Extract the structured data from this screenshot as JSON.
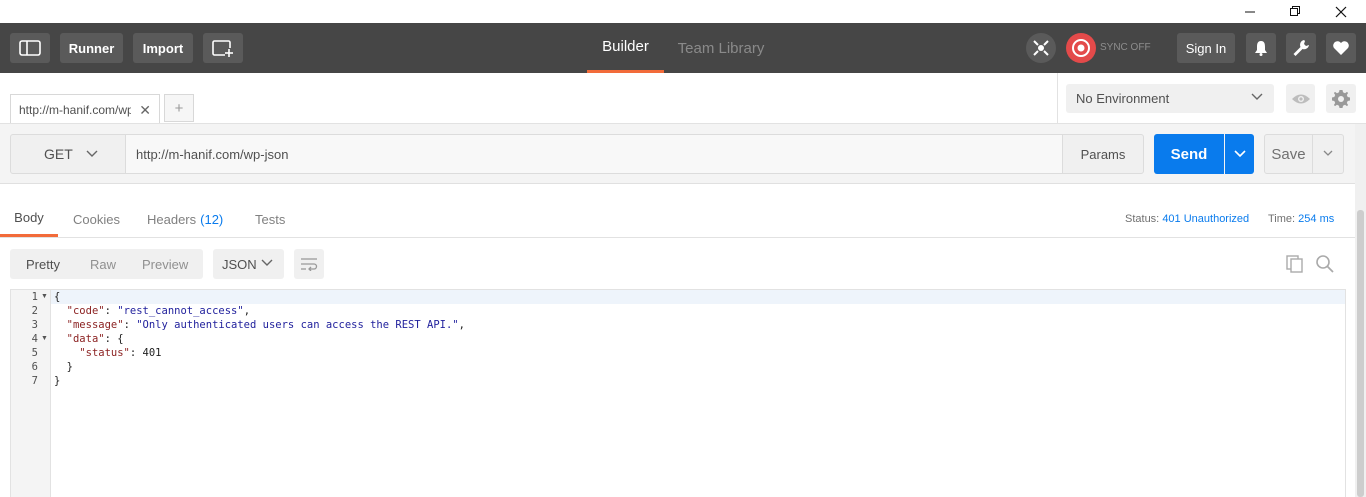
{
  "window": {
    "minimize": "—",
    "restore": "❐",
    "close": "✕"
  },
  "header": {
    "runner": "Runner",
    "import": "Import",
    "tabs": [
      {
        "label": "Builder",
        "active": true
      },
      {
        "label": "Team Library",
        "active": false
      }
    ],
    "sync_label": "SYNC OFF",
    "sign_in": "Sign In",
    "accent": "#f26b3a"
  },
  "request_tab": {
    "title": "http://m-hanif.com/wp-json",
    "add": "+"
  },
  "environment": {
    "selected": "No Environment"
  },
  "request": {
    "method": "GET",
    "url": "http://m-hanif.com/wp-json",
    "params": "Params",
    "send": "Send",
    "save": "Save",
    "send_color": "#097bed"
  },
  "response": {
    "tabs": {
      "body": "Body",
      "cookies": "Cookies",
      "headers": "Headers",
      "headers_count": "(12)",
      "tests": "Tests"
    },
    "status_label": "Status:",
    "status_value": "401 Unauthorized",
    "time_label": "Time:",
    "time_value": "254 ms",
    "view_modes": [
      "Pretty",
      "Raw",
      "Preview"
    ],
    "format": "JSON",
    "lines": [
      {
        "n": "1",
        "fold": true
      },
      {
        "n": "2",
        "fold": false
      },
      {
        "n": "3",
        "fold": false
      },
      {
        "n": "4",
        "fold": true
      },
      {
        "n": "5",
        "fold": false
      },
      {
        "n": "6",
        "fold": false
      },
      {
        "n": "7",
        "fold": false
      }
    ],
    "code": {
      "code_key": "\"code\"",
      "code_val": "\"rest_cannot_access\"",
      "message_key": "\"message\"",
      "message_val": "\"Only authenticated users can access the REST API.\"",
      "data_key": "\"data\"",
      "status_key": "\"status\"",
      "status_val": "401"
    }
  }
}
